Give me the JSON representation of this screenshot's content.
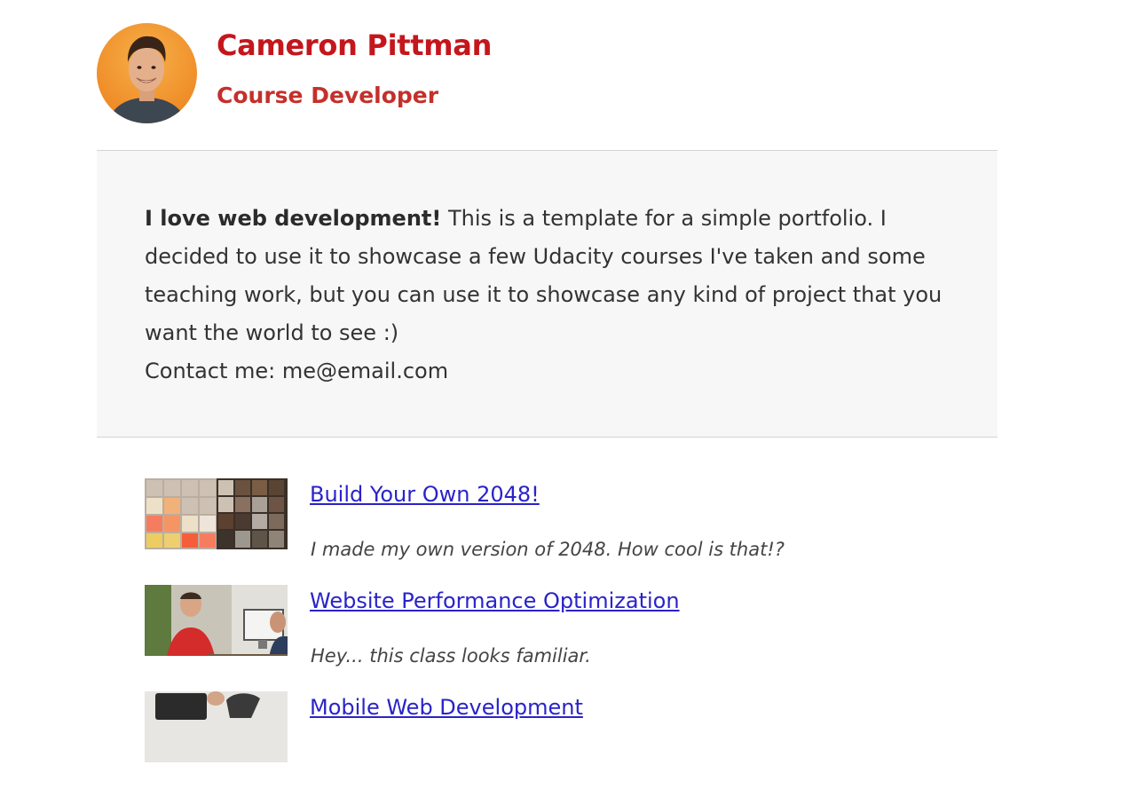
{
  "profile": {
    "name": "Cameron Pittman",
    "role": "Course Developer",
    "avatar_icon": "person-avatar"
  },
  "about": {
    "lead": "I love web development!",
    "text": " This is a template for a simple portfolio. I decided to use it to showcase a few Udacity courses I've taken and some teaching work, but you can use it to showcase any kind of project that you want the world to see :)",
    "contact": "Contact me: me@email.com"
  },
  "projects": [
    {
      "title": "Build Your Own 2048!",
      "description": "I made my own version of 2048. How cool is that!?",
      "thumb_icon": "2048-game-thumbnail"
    },
    {
      "title": "Website Performance Optimization",
      "description": "Hey... this class looks familiar.",
      "thumb_icon": "classroom-photo-thumbnail"
    },
    {
      "title": "Mobile Web Development",
      "description": "",
      "thumb_icon": "mobile-device-thumbnail"
    }
  ],
  "colors": {
    "accent": "#c4161c",
    "link": "#2a23c9",
    "about_bg": "#f7f7f7"
  }
}
